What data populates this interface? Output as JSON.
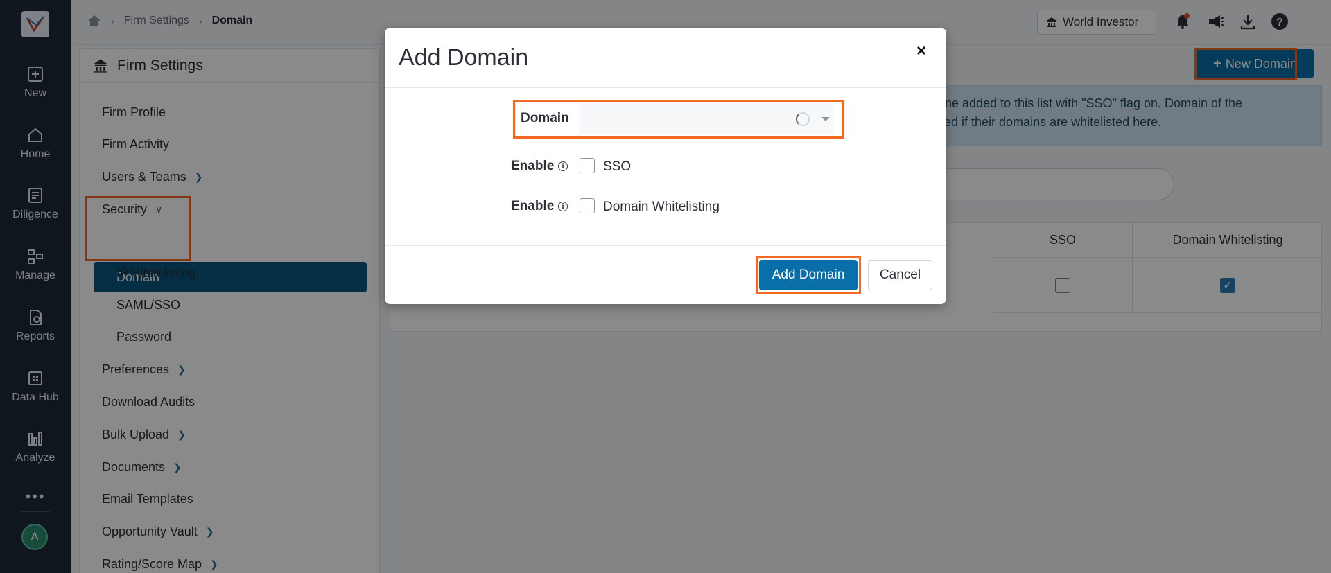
{
  "rail": {
    "items": [
      {
        "label": "New",
        "icon": "plus-square-icon"
      },
      {
        "label": "Home",
        "icon": "home-icon"
      },
      {
        "label": "Diligence",
        "icon": "diligence-icon"
      },
      {
        "label": "Manage",
        "icon": "manage-icon"
      },
      {
        "label": "Reports",
        "icon": "reports-icon"
      },
      {
        "label": "Data Hub",
        "icon": "data-hub-icon"
      },
      {
        "label": "Analyze",
        "icon": "bar-chart-icon"
      }
    ],
    "more": "•••",
    "avatar": "A"
  },
  "breadcrumb": {
    "items": [
      "Firm Settings",
      "Domain"
    ]
  },
  "topbar": {
    "firm_button": "World Investor"
  },
  "settings": {
    "title": "Firm Settings",
    "menu": {
      "firm_profile": "Firm Profile",
      "firm_activity": "Firm Activity",
      "users_teams": "Users & Teams",
      "security": "Security",
      "domain": "Domain",
      "ip_whitelisting": "IP Whitelisting",
      "saml_sso": "SAML/SSO",
      "password": "Password",
      "preferences": "Preferences",
      "download_audits": "Download Audits",
      "bulk_upload": "Bulk Upload",
      "documents": "Documents",
      "email_templates": "Email Templates",
      "opportunity_vault": "Opportunity Vault",
      "rating_score_map": "Rating/Score Map"
    }
  },
  "main": {
    "new_domain_button": "New Domain",
    "info_line1": "one added to this list with \"SSO\" flag on. Domain of the",
    "info_line2": "ved if their domains are whitelisted here.",
    "table": {
      "headers": {
        "sso": "SSO",
        "domain_whitelisting": "Domain Whitelisting"
      },
      "rows": [
        {
          "sso": false,
          "domain_whitelisting": true
        }
      ]
    }
  },
  "modal": {
    "title": "Add Domain",
    "close": "×",
    "domain_label": "Domain",
    "enable_label": "Enable",
    "sso_label": "SSO",
    "whitelisting_label": "Domain Whitelisting",
    "add_button": "Add Domain",
    "cancel_button": "Cancel"
  },
  "colors": {
    "rail": "#1e2a38",
    "primary": "#0a6ea8",
    "active_menu": "#08567f",
    "highlight": "#f26a21",
    "info_bg": "#cfe3f2"
  }
}
